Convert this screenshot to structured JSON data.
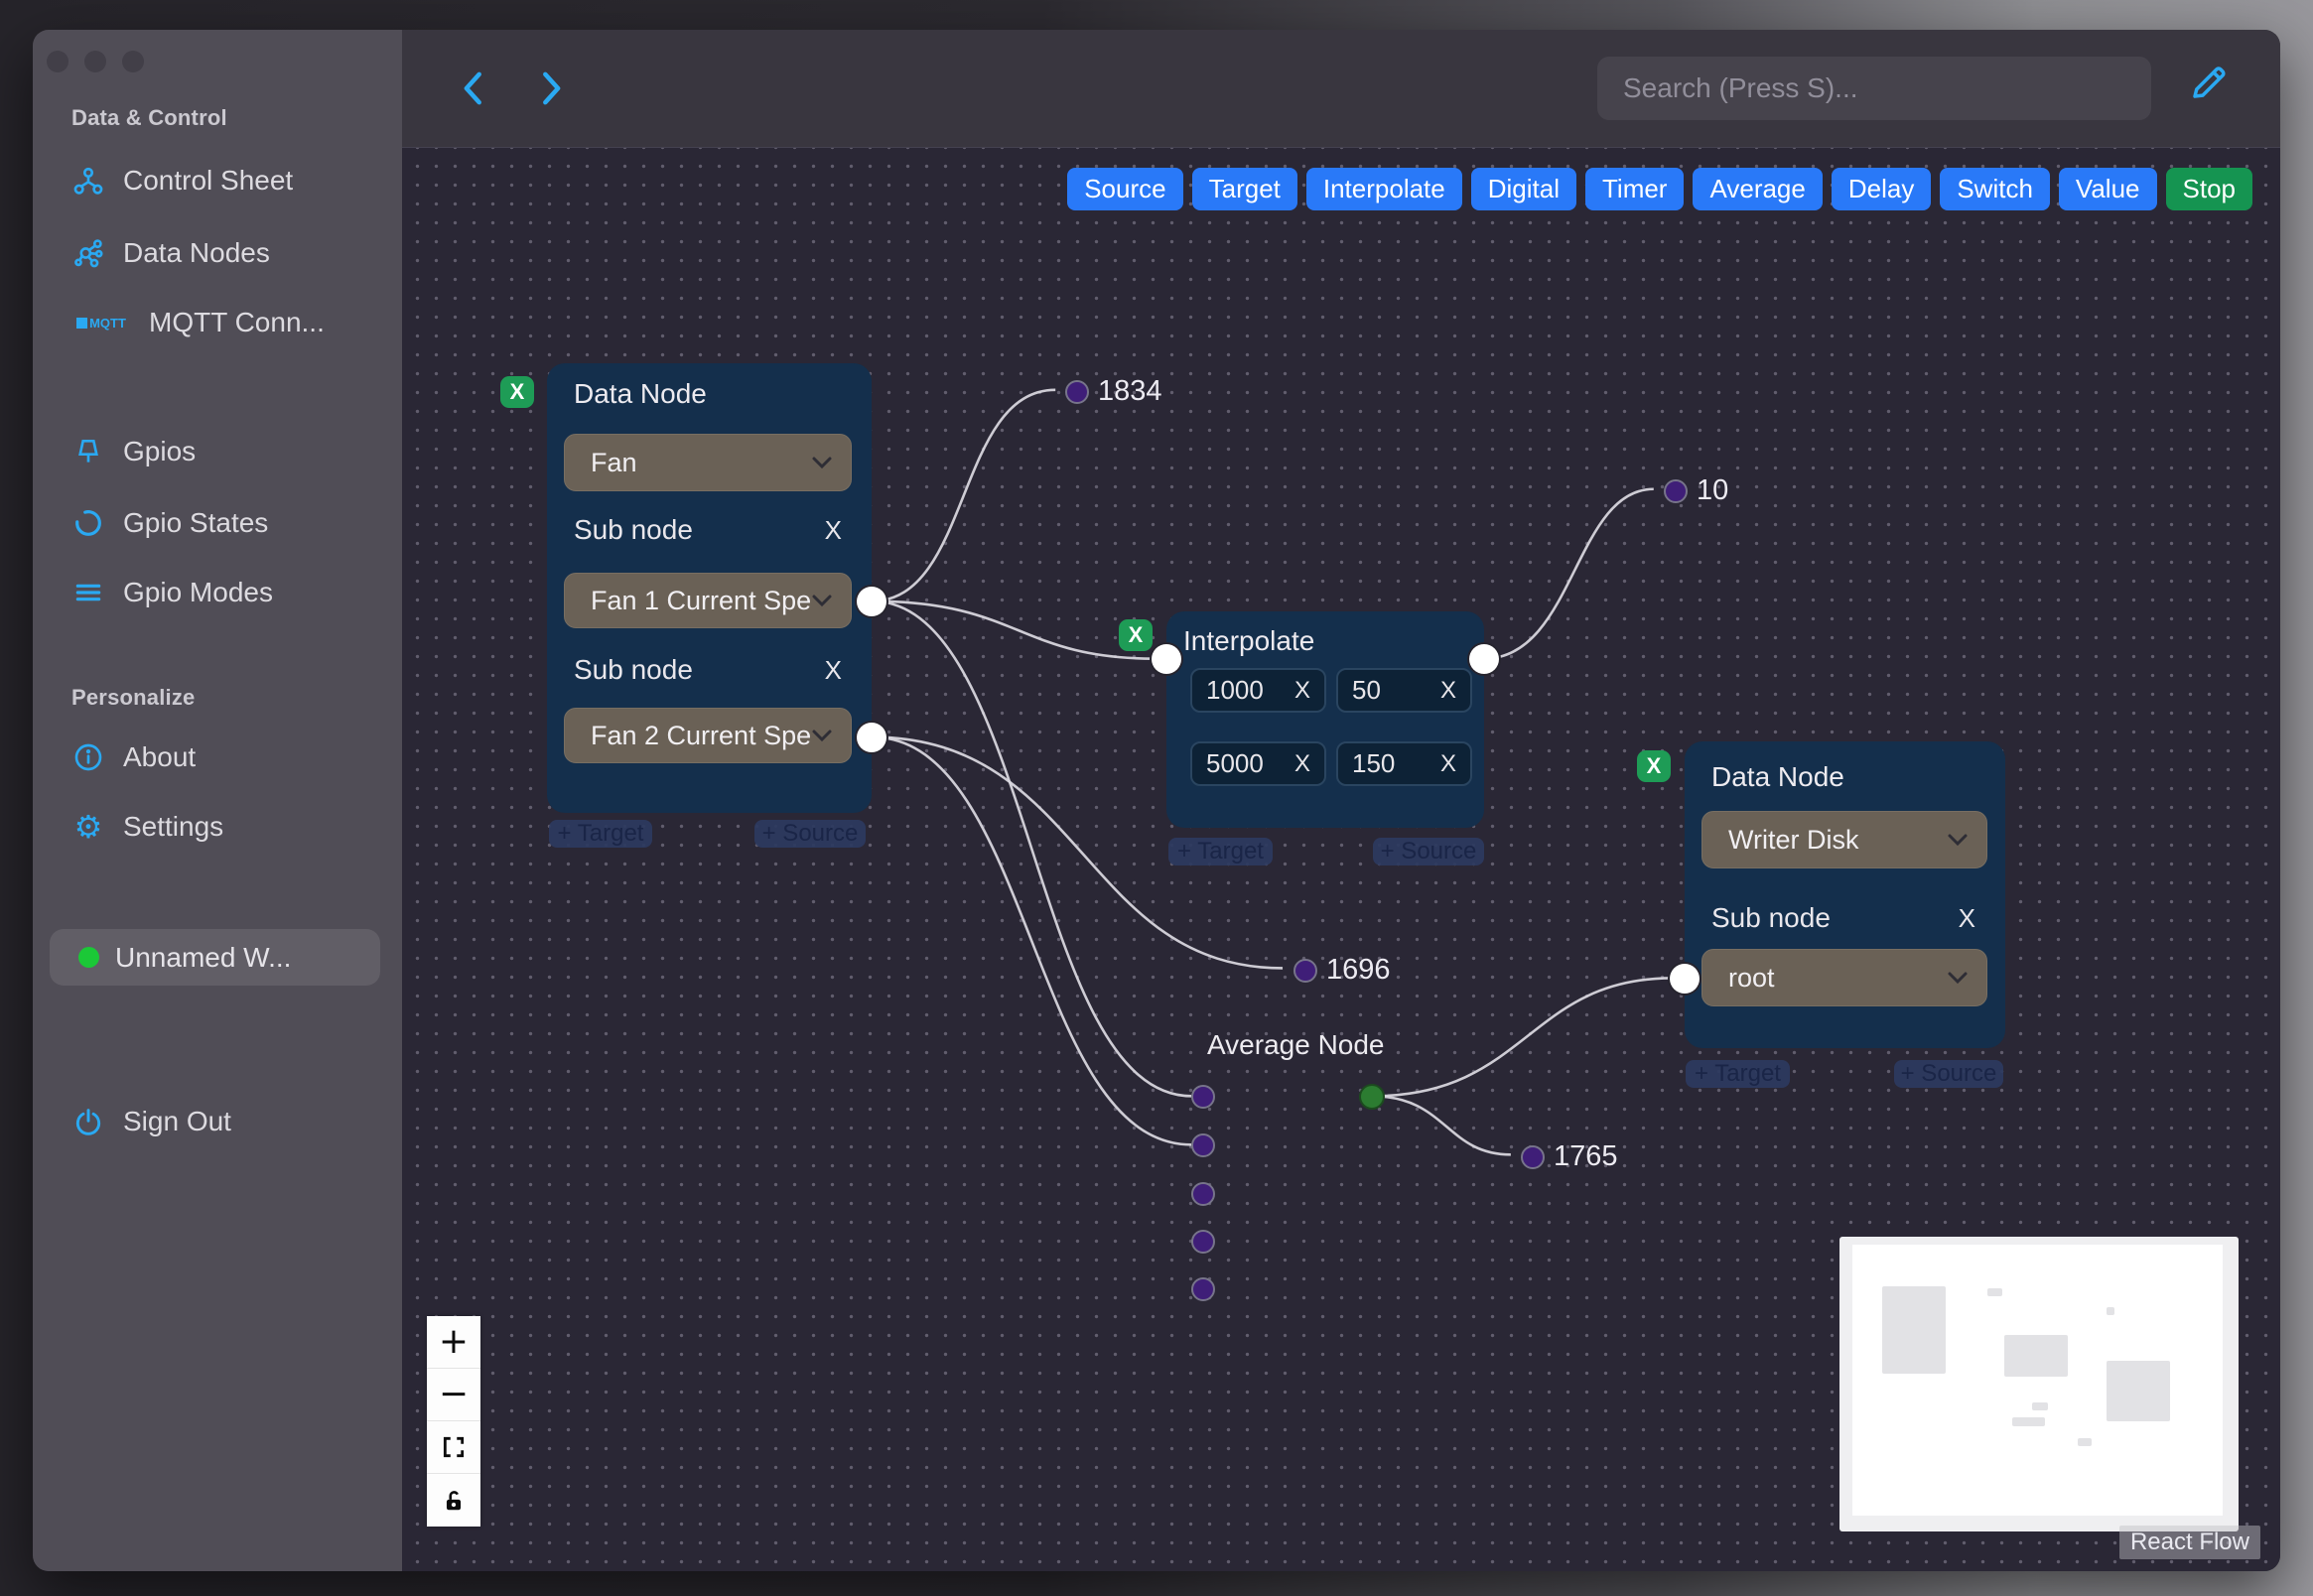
{
  "sidebar": {
    "section_data_control": "Data & Control",
    "items": [
      {
        "label": "Control Sheet"
      },
      {
        "label": "Data Nodes"
      },
      {
        "label": "MQTT Conn..."
      },
      {
        "label": "Gpios"
      },
      {
        "label": "Gpio States"
      },
      {
        "label": "Gpio Modes"
      }
    ],
    "section_personalize": "Personalize",
    "about_label": "About",
    "settings_label": "Settings",
    "workflow_label": "Unnamed W...",
    "workflow_status_color": "#1bc837",
    "sign_out_label": "Sign Out",
    "mqtt_icon_text": "MQTT"
  },
  "header": {
    "search_placeholder": "Search (Press S)..."
  },
  "toolbar": {
    "buttons": [
      {
        "label": "Source"
      },
      {
        "label": "Target"
      },
      {
        "label": "Interpolate"
      },
      {
        "label": "Digital"
      },
      {
        "label": "Timer"
      },
      {
        "label": "Average"
      },
      {
        "label": "Delay"
      },
      {
        "label": "Switch"
      },
      {
        "label": "Value"
      },
      {
        "label": "Stop"
      }
    ],
    "button_color": "#2979f8",
    "stop_color": "#159451"
  },
  "shared": {
    "x_label": "X",
    "target_pill": "+ Target",
    "source_pill": "+ Source"
  },
  "nodes": {
    "fan": {
      "title": "Data Node",
      "device_value": "Fan",
      "sub1_label": "Sub node",
      "sub1_value": "Fan 1 Current Spe",
      "sub2_label": "Sub node",
      "sub2_value": "Fan 2 Current Spe"
    },
    "interpolate": {
      "title": "Interpolate",
      "inputs": [
        "1000",
        "50",
        "5000",
        "150"
      ]
    },
    "writer": {
      "title": "Data Node",
      "device_value": "Writer Disk",
      "sub_label": "Sub node",
      "sub_value": "root"
    },
    "average": {
      "title": "Average Node"
    }
  },
  "edge_labels": {
    "l1834": "1834",
    "l10": "10",
    "l1696": "1696",
    "l1765": "1765"
  },
  "attribution": "React Flow"
}
